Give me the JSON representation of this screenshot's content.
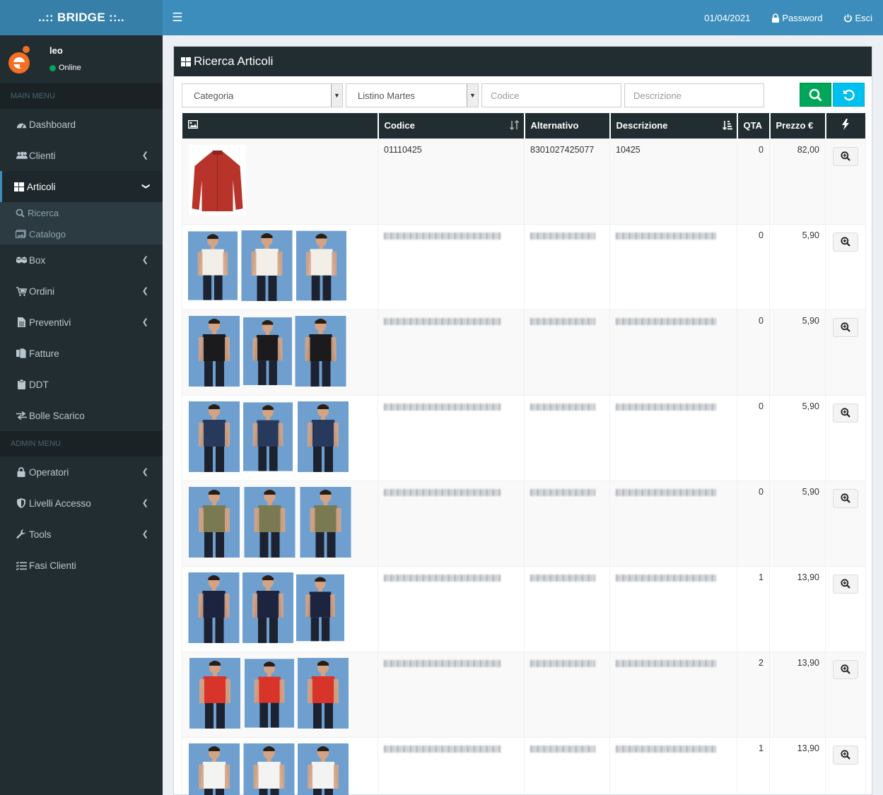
{
  "app": {
    "brand": "..:: BRIDGE ::..",
    "date": "01/04/2021",
    "password_label": "Password",
    "logout_label": "Esci"
  },
  "user": {
    "name": "leo",
    "status": "Online"
  },
  "sidebar": {
    "main_header": "MAIN MENU",
    "admin_header": "ADMIN MENU",
    "items": [
      {
        "label": "Dashboard",
        "icon": "dashboard-icon"
      },
      {
        "label": "Clienti",
        "icon": "users-icon"
      },
      {
        "label": "Articoli",
        "icon": "grid-icon"
      },
      {
        "label": "Box",
        "icon": "cubes-icon"
      },
      {
        "label": "Ordini",
        "icon": "cart-icon"
      },
      {
        "label": "Preventivi",
        "icon": "file-icon"
      },
      {
        "label": "Fatture",
        "icon": "copy-icon"
      },
      {
        "label": "DDT",
        "icon": "clipboard-icon"
      },
      {
        "label": "Bolle Scarico",
        "icon": "exchange-icon"
      }
    ],
    "sub_items": [
      {
        "label": "Ricerca",
        "icon": "search-icon"
      },
      {
        "label": "Catalogo",
        "icon": "image-icon"
      }
    ],
    "admin_items": [
      {
        "label": "Operatori",
        "icon": "lock-icon"
      },
      {
        "label": "Livelli Accesso",
        "icon": "shield-icon"
      },
      {
        "label": "Tools",
        "icon": "wrench-icon"
      },
      {
        "label": "Fasi Clienti",
        "icon": "tasks-icon"
      }
    ]
  },
  "page": {
    "title": "Ricerca Articoli"
  },
  "filters": {
    "categoria": "Categoria",
    "listino": "Listino Martes",
    "codice_placeholder": "Codice",
    "descrizione_placeholder": "Descrizione"
  },
  "table": {
    "headers": [
      "Codice",
      "Alternativo",
      "Descrizione",
      "QTA",
      "Prezzo €"
    ],
    "rows": [
      {
        "codice": "01110425",
        "alternativo": "8301027425077",
        "descrizione": "10425",
        "qta": "0",
        "prezzo": "82,00",
        "colors": [
          "#b8332a"
        ],
        "blurred": false
      },
      {
        "codice": "",
        "alternativo": "",
        "descrizione": "",
        "qta": "0",
        "prezzo": "5,90",
        "colors": [
          "#f2efe8",
          "#f2efe8",
          "#f2efe8"
        ],
        "blurred": true
      },
      {
        "codice": "",
        "alternativo": "",
        "descrizione": "",
        "qta": "0",
        "prezzo": "5,90",
        "colors": [
          "#1b1b1d",
          "#1b1b1d",
          "#1b1b1d"
        ],
        "blurred": true
      },
      {
        "codice": "",
        "alternativo": "",
        "descrizione": "",
        "qta": "0",
        "prezzo": "5,90",
        "colors": [
          "#283a5c",
          "#283a5c",
          "#283a5c"
        ],
        "blurred": true
      },
      {
        "codice": "",
        "alternativo": "",
        "descrizione": "",
        "qta": "0",
        "prezzo": "5,90",
        "colors": [
          "#7a7a52",
          "#7a7a52",
          "#7a7a52"
        ],
        "blurred": true
      },
      {
        "codice": "",
        "alternativo": "",
        "descrizione": "",
        "qta": "1",
        "prezzo": "13,90",
        "colors": [
          "#1c2440",
          "#1c2440",
          "#1c2440"
        ],
        "blurred": true
      },
      {
        "codice": "",
        "alternativo": "",
        "descrizione": "",
        "qta": "2",
        "prezzo": "13,90",
        "colors": [
          "#d8342a",
          "#d8342a",
          "#d8342a"
        ],
        "blurred": true
      },
      {
        "codice": "",
        "alternativo": "",
        "descrizione": "",
        "qta": "1",
        "prezzo": "13,90",
        "colors": [
          "#f3f3f1",
          "#f3f3f1",
          "#f3f3f1"
        ],
        "blurred": true
      }
    ]
  }
}
